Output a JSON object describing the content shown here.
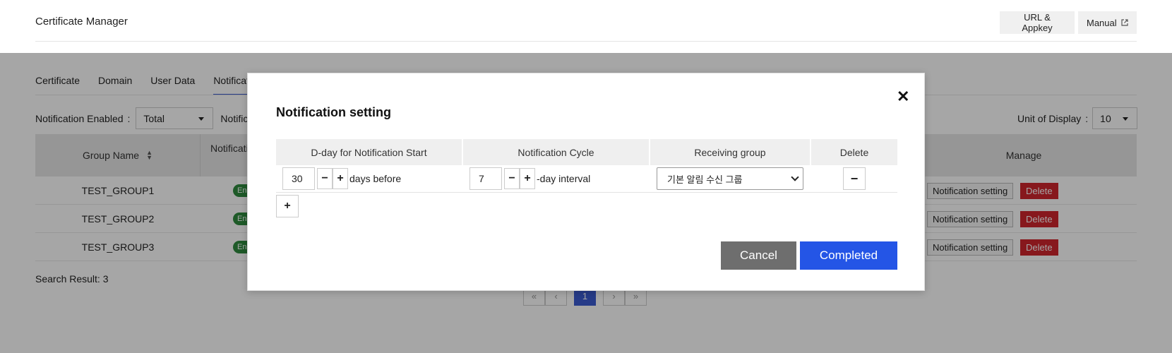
{
  "header": {
    "title": "Certificate Manager",
    "url_appkey_label": "URL & Appkey",
    "manual_label": "Manual"
  },
  "tabs": [
    "Certificate",
    "Domain",
    "User Data",
    "Notification"
  ],
  "filters": {
    "enabled_label": "Notification Enabled",
    "enabled_value": "Total",
    "second_label": "Notification",
    "display_label": "Unit of Display",
    "display_value": "10"
  },
  "grid": {
    "columns": {
      "group_name": "Group Name",
      "notification": "Notification",
      "manage": "Manage"
    },
    "rows": [
      {
        "name": "TEST_GROUP1",
        "badge": "Enabled"
      },
      {
        "name": "TEST_GROUP2",
        "badge": "Enabled"
      },
      {
        "name": "TEST_GROUP3",
        "badge": "Enabled"
      }
    ],
    "notification_setting_label": "Notification setting",
    "delete_label": "Delete"
  },
  "search_result": "Search Result: 3",
  "pager": {
    "current": "1"
  },
  "modal": {
    "title": "Notification setting",
    "columns": {
      "dday": "D-day for Notification Start",
      "cycle": "Notification Cycle",
      "group": "Receiving group",
      "delete": "Delete"
    },
    "row": {
      "dday_value": "30",
      "dday_suffix": "days before",
      "cycle_value": "7",
      "cycle_suffix": "-day interval",
      "group_value": "기본 알림 수신 그룹"
    },
    "cancel_label": "Cancel",
    "complete_label": "Completed"
  }
}
